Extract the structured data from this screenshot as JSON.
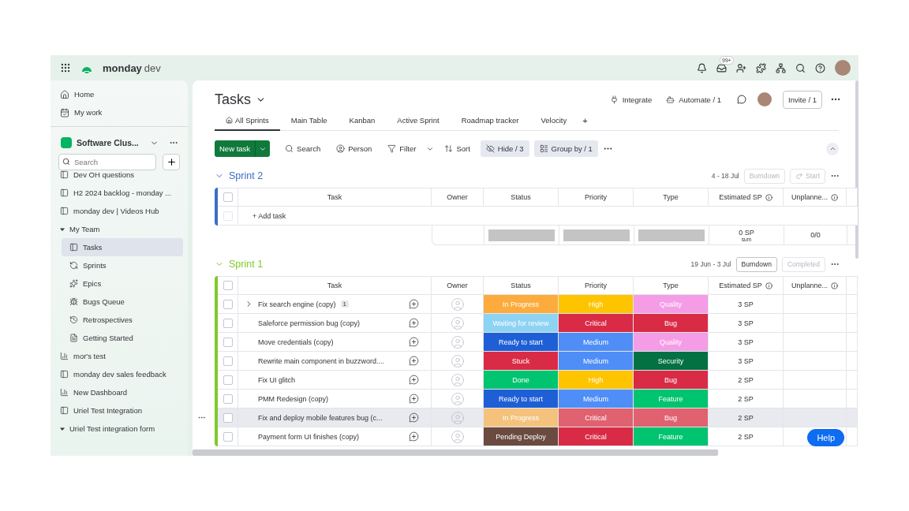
{
  "topbar": {
    "brand": "monday",
    "brand_suffix": "dev",
    "inbox_badge": "99+"
  },
  "sidebar": {
    "nav": [
      {
        "label": "Home",
        "kind": "home"
      },
      {
        "label": "My work",
        "kind": "mywork"
      }
    ],
    "workspace": {
      "name": "Software Clus..."
    },
    "search": {
      "placeholder": "Search"
    },
    "items": [
      {
        "label": "Dev OH questions",
        "kind": "board",
        "selected": false
      },
      {
        "label": "H2 2024 backlog - monday ...",
        "kind": "board",
        "selected": false
      },
      {
        "label": "monday dev | Videos Hub",
        "kind": "board",
        "selected": false
      },
      {
        "label": "My Team",
        "kind": "folder",
        "expanded": true,
        "selected": false,
        "children": [
          {
            "label": "Tasks",
            "kind": "board",
            "selected": true
          },
          {
            "label": "Sprints",
            "kind": "sprints",
            "selected": false
          },
          {
            "label": "Epics",
            "kind": "epics",
            "selected": false
          },
          {
            "label": "Bugs Queue",
            "kind": "bugs",
            "selected": false
          },
          {
            "label": "Retrospectives",
            "kind": "history",
            "selected": false
          },
          {
            "label": "Getting Started",
            "kind": "doc",
            "selected": false
          }
        ]
      },
      {
        "label": "mor's test",
        "kind": "dashboard",
        "selected": false
      },
      {
        "label": "monday dev sales feedback",
        "kind": "board",
        "selected": false
      },
      {
        "label": "New Dashboard",
        "kind": "dashboard",
        "selected": false
      },
      {
        "label": "Uriel Test Integration",
        "kind": "board",
        "selected": false
      },
      {
        "label": "Uriel Test integration form",
        "kind": "folder",
        "expanded": true,
        "selected": false
      }
    ]
  },
  "board": {
    "title": "Tasks",
    "actions": [
      {
        "label": "Integrate",
        "kind": "integrate"
      },
      {
        "label": "Automate / 1",
        "kind": "automate"
      }
    ],
    "invite": "Invite / 1",
    "tabs": [
      {
        "label": "All Sprints",
        "selected": true
      },
      {
        "label": "Main Table",
        "selected": false
      },
      {
        "label": "Kanban",
        "selected": false
      },
      {
        "label": "Active Sprint",
        "selected": false
      },
      {
        "label": "Roadmap tracker",
        "selected": false
      },
      {
        "label": "Velocity",
        "selected": false
      }
    ],
    "add_tab": "+",
    "new_task": "New task",
    "tools": [
      {
        "label": "Search",
        "kind": "search",
        "active": false
      },
      {
        "label": "Person",
        "kind": "person",
        "active": false
      },
      {
        "label": "Filter",
        "kind": "filter",
        "active": false
      },
      {
        "label": "Sort",
        "kind": "sort",
        "active": false
      },
      {
        "label": "Hide / 3",
        "kind": "hide",
        "active": true
      },
      {
        "label": "Group by / 1",
        "kind": "group",
        "active": true
      }
    ],
    "groups": [
      {
        "name": "Sprint 2",
        "color": "#3a6fc4",
        "dates": "4 - 18 Jul",
        "header_checked": false,
        "buttons": [
          {
            "label": "Burndown",
            "kind": "plain",
            "disabled": true
          },
          {
            "label": "Start",
            "kind": "start",
            "disabled": true
          }
        ],
        "columns": [
          {
            "label": "Task",
            "info": false
          },
          {
            "label": "Owner",
            "info": false
          },
          {
            "label": "Status",
            "info": false
          },
          {
            "label": "Priority",
            "info": false
          },
          {
            "label": "Type",
            "info": false
          },
          {
            "label": "Estimated SP",
            "info": true
          },
          {
            "label": "Unplanne...",
            "info": true
          }
        ],
        "add_task": "+ Add task",
        "summary": {
          "sp": "0 SP",
          "sp_caption": "sum",
          "unplanned": "0/0"
        }
      },
      {
        "name": "Sprint 1",
        "color": "#7fc92a",
        "dates": "19 Jun - 3 Jul",
        "header_checked": false,
        "buttons": [
          {
            "label": "Burndown",
            "kind": "plain",
            "disabled": false
          },
          {
            "label": "Completed",
            "kind": "plain",
            "disabled": true
          }
        ],
        "columns": [
          {
            "label": "Task",
            "info": false
          },
          {
            "label": "Owner",
            "info": false
          },
          {
            "label": "Status",
            "info": false
          },
          {
            "label": "Priority",
            "info": false
          },
          {
            "label": "Type",
            "info": false
          },
          {
            "label": "Estimated SP",
            "info": true
          },
          {
            "label": "Unplanne...",
            "info": true
          }
        ],
        "rows": [
          {
            "task": "Fix search engine (copy)",
            "subitems": "1",
            "checked": false,
            "hovered": false,
            "status": {
              "label": "In Progress",
              "color": "#fdab3d"
            },
            "priority": {
              "label": "High",
              "color": "#ffc400"
            },
            "type": {
              "label": "Quality",
              "color": "#f49de6"
            },
            "sp": "3 SP"
          },
          {
            "task": "Saleforce permission bug (copy)",
            "checked": false,
            "hovered": false,
            "status": {
              "label": "Waiting for review",
              "color": "#8fd3f2"
            },
            "priority": {
              "label": "Critical",
              "color": "#d92b45"
            },
            "type": {
              "label": "Bug",
              "color": "#d92b45"
            },
            "sp": "3 SP"
          },
          {
            "task": "Move credentials (copy)",
            "checked": false,
            "hovered": false,
            "status": {
              "label": "Ready to start",
              "color": "#1f5fd6"
            },
            "priority": {
              "label": "Medium",
              "color": "#4f8ef7"
            },
            "type": {
              "label": "Quality",
              "color": "#f49de6"
            },
            "sp": "3 SP"
          },
          {
            "task": "Rewrite main component in buzzword....",
            "checked": false,
            "hovered": false,
            "status": {
              "label": "Stuck",
              "color": "#d92b45"
            },
            "priority": {
              "label": "Medium",
              "color": "#4f8ef7"
            },
            "type": {
              "label": "Security",
              "color": "#037142"
            },
            "sp": "3 SP"
          },
          {
            "task": "Fix UI glitch",
            "checked": false,
            "hovered": false,
            "status": {
              "label": "Done",
              "color": "#00c46f"
            },
            "priority": {
              "label": "High",
              "color": "#ffc400"
            },
            "type": {
              "label": "Bug",
              "color": "#d92b45"
            },
            "sp": "2 SP"
          },
          {
            "task": "PMM Redesign (copy)",
            "checked": false,
            "hovered": false,
            "status": {
              "label": "Ready to start",
              "color": "#1f5fd6"
            },
            "priority": {
              "label": "Medium",
              "color": "#4f8ef7"
            },
            "type": {
              "label": "Feature",
              "color": "#00c46f"
            },
            "sp": "2 SP"
          },
          {
            "task": "Fix and deploy mobile features bug (c...",
            "checked": false,
            "hovered": true,
            "status": {
              "label": "In Progress",
              "color": "#f4c27c"
            },
            "priority": {
              "label": "Critical",
              "color": "#e0616f"
            },
            "type": {
              "label": "Bug",
              "color": "#e0616f"
            },
            "sp": "2 SP"
          },
          {
            "task": "Payment form UI finishes (copy)",
            "checked": false,
            "hovered": false,
            "status": {
              "label": "Pending Deploy",
              "color": "#6b4a40"
            },
            "priority": {
              "label": "Critical",
              "color": "#d92b45"
            },
            "type": {
              "label": "Feature",
              "color": "#00c46f"
            },
            "sp": "2 SP"
          }
        ]
      }
    ]
  },
  "help": "Help"
}
